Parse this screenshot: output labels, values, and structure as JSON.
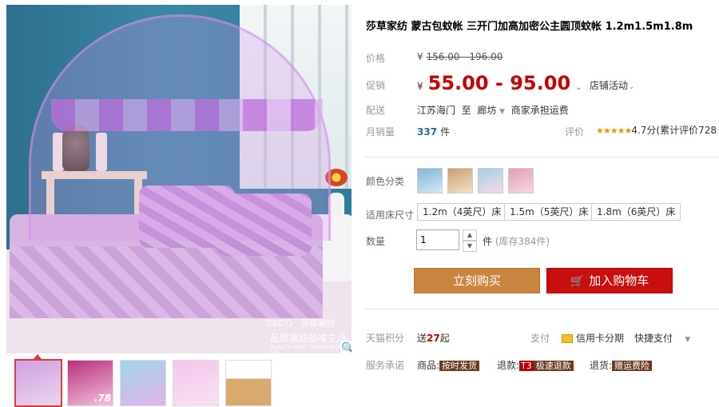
{
  "image_overlay": {
    "logo": "SECO",
    "logo_brand": "莎草家纺",
    "slogan": "品质家纺品味生活",
    "small_text": "QUALITY HOME TEXTILE TASTE LIFE"
  },
  "thumbnails": [
    {
      "name": "thumb-1",
      "colors": [
        "#cfa0e0",
        "#e9d6ef"
      ]
    },
    {
      "name": "thumb-2",
      "colors": [
        "#b7307c",
        "#f3c2dc"
      ],
      "badge": ".78"
    },
    {
      "name": "thumb-3",
      "colors": [
        "#9fd7ea",
        "#e0b2ea"
      ]
    },
    {
      "name": "thumb-4",
      "colors": [
        "#f3c6ea",
        "#f9e1f4"
      ]
    },
    {
      "name": "thumb-5",
      "colors": [
        "#d9a970",
        "#f2e4d2"
      ]
    }
  ],
  "product": {
    "title": "莎草家纺 蒙古包蚊帐 三开门加高加密公主圆顶蚊帐 1.2m1.5m1.8m",
    "labels": {
      "price": "价格",
      "promo": "促销",
      "ship": "配送",
      "sales": "月销量",
      "rating": "评价",
      "color": "颜色分类",
      "size": "适用床尺寸",
      "qty": "数量",
      "points": "天猫积分",
      "pay": "支付",
      "promise": "服务承诺"
    },
    "original_price": "156.00 - 196.00",
    "currency": "¥",
    "promo_price": "55.00 - 95.00",
    "shop_promo": "店铺活动",
    "ship_from": "江苏海门",
    "ship_to_word": "至",
    "ship_to": "廊坊",
    "ship_note": "商家承担运费",
    "monthly_sales": "337",
    "sales_unit": "件",
    "rating_stars": 4.7,
    "rating_text": "4.7分(累计评价728",
    "sizes": [
      "1.2m（4英尺）床",
      "1.5m（5英尺）床",
      "1.8m（6英尺）床"
    ],
    "qty_value": "1",
    "stock_unit": "件",
    "stock_text": "(库存384件)",
    "buy_now": "立刻购买",
    "add_cart": "加入购物车",
    "points_send": "送",
    "points_value": "27",
    "points_unit": "起",
    "credit_pay": "信用卡分期",
    "quick_pay": "快捷支付",
    "promise": {
      "goods_pre": "商品:",
      "goods_tag": "按时发货",
      "return_pre": "退款:",
      "return_t3": "T3",
      "return_tag": "极速退款",
      "ret_goods_pre": "退货:",
      "ret_goods_tag": "赠运费险"
    }
  },
  "colors": {
    "price_red": "#c40000",
    "buy_button": "#c9853f",
    "cart_button": "#c70f0f",
    "sales_blue": "#2b6aa0"
  }
}
